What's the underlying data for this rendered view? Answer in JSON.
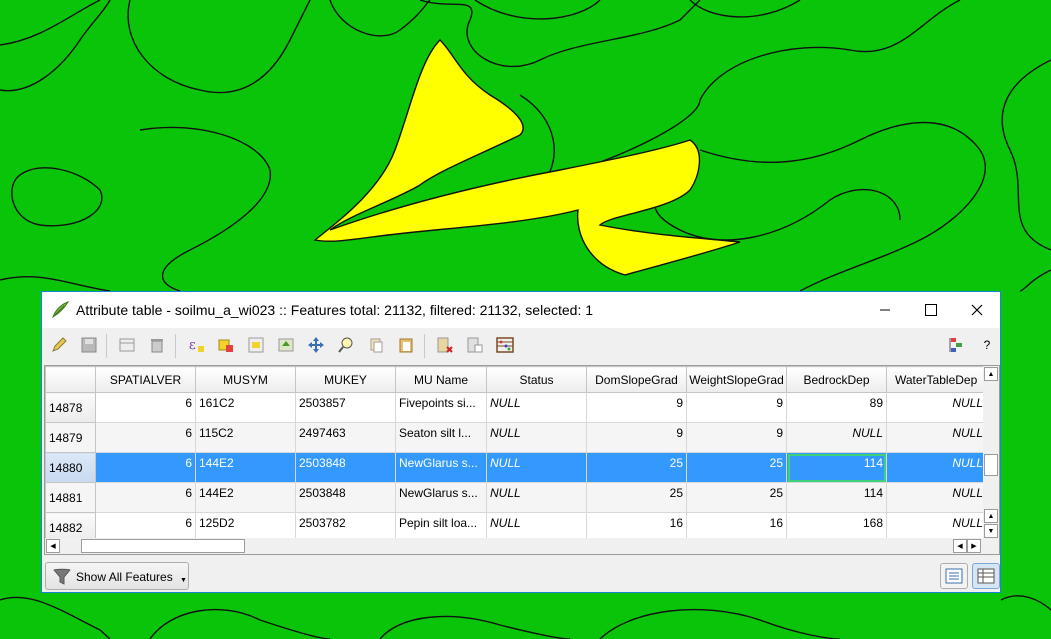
{
  "window": {
    "title": "Attribute table - soilmu_a_wi023 :: Features total: 21132, filtered: 21132, selected: 1",
    "help": "?"
  },
  "table": {
    "columns": [
      "SPATIALVER",
      "MUSYM",
      "MUKEY",
      "MU Name",
      "Status",
      "DomSlopeGrad",
      "WeightSlopeGrad",
      "BedrockDep",
      "WaterTableDep"
    ],
    "rows": [
      {
        "id": "14878",
        "cells": [
          "6",
          "161C2",
          "2503857",
          "Fivepoints si...",
          "NULL",
          "9",
          "9",
          "89",
          "NULL"
        ]
      },
      {
        "id": "14879",
        "cells": [
          "6",
          "115C2",
          "2497463",
          "Seaton silt l...",
          "NULL",
          "9",
          "9",
          "NULL",
          "NULL"
        ]
      },
      {
        "id": "14880",
        "cells": [
          "6",
          "144E2",
          "2503848",
          "NewGlarus s...",
          "NULL",
          "25",
          "25",
          "114",
          "NULL"
        ]
      },
      {
        "id": "14881",
        "cells": [
          "6",
          "144E2",
          "2503848",
          "NewGlarus s...",
          "NULL",
          "25",
          "25",
          "114",
          "NULL"
        ]
      },
      {
        "id": "14882",
        "cells": [
          "6",
          "125D2",
          "2503782",
          "Pepin silt loa...",
          "NULL",
          "16",
          "16",
          "168",
          "NULL"
        ]
      }
    ],
    "selected_row": "14880"
  },
  "footer": {
    "filter_button": "Show All Features"
  },
  "colors": {
    "map_background": "#0ac40a",
    "selected_feature": "#ffff00",
    "selection_highlight": "#3399ff"
  }
}
